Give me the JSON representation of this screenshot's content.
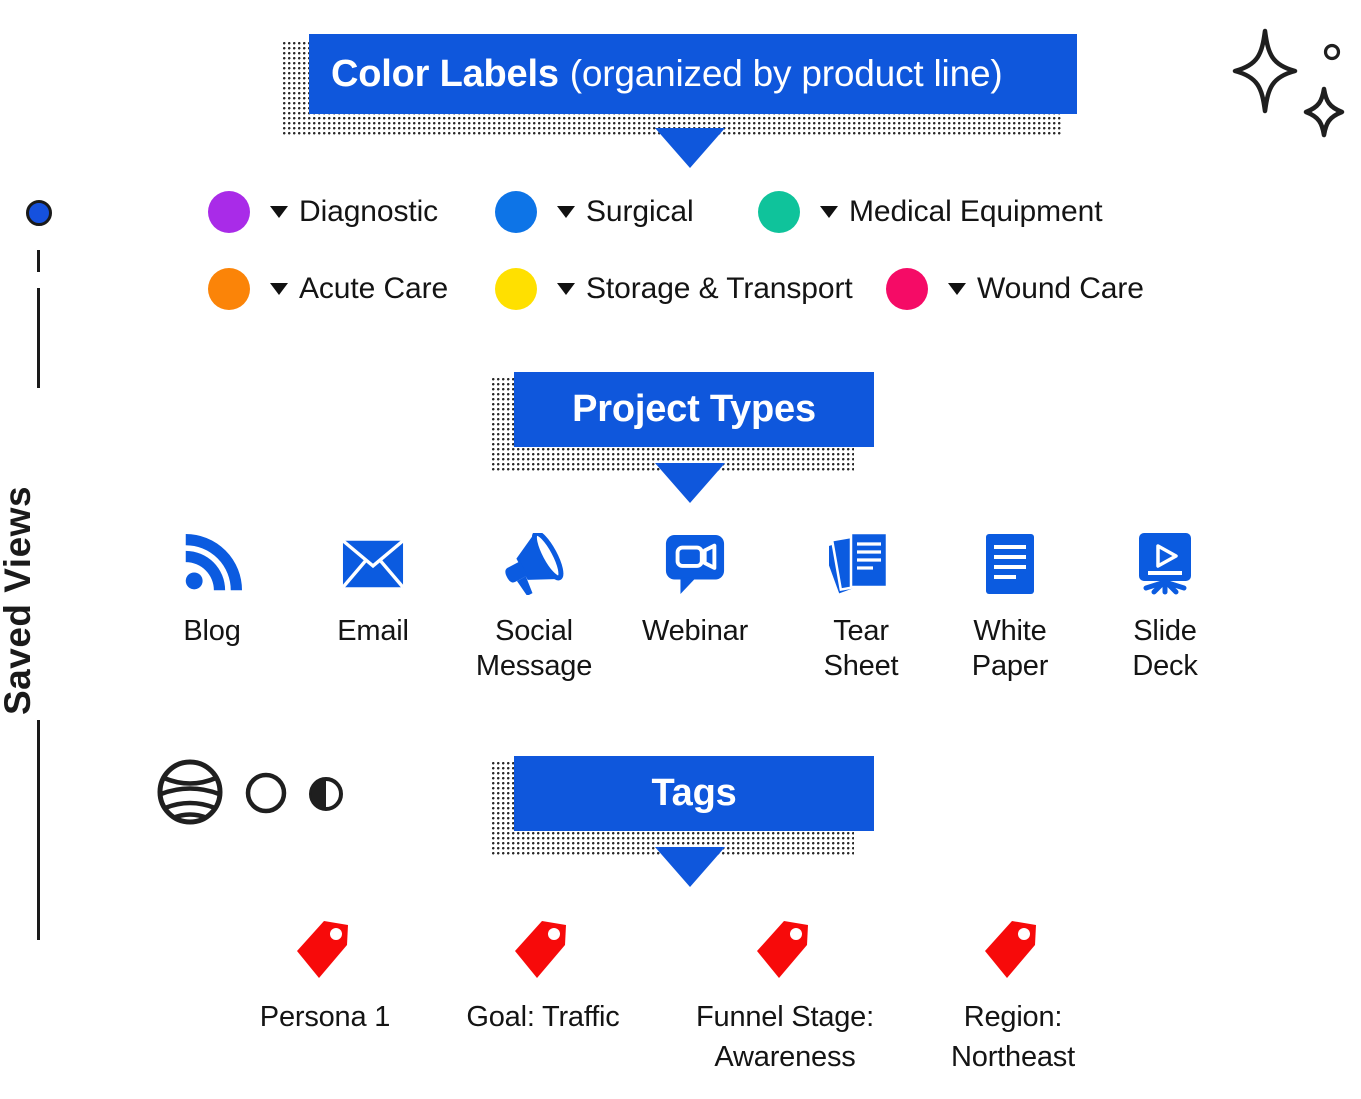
{
  "sidebar": {
    "label": "Saved Views",
    "dot_color": "#1551DE"
  },
  "sections": [
    {
      "id": "color-labels",
      "title_strong": "Color Labels",
      "title_light": "(organized by product line)",
      "banner_color": "#0F57DC"
    },
    {
      "id": "project-types",
      "title_strong": "Project Types",
      "banner_color": "#0F57DC"
    },
    {
      "id": "tags",
      "title_strong": "Tags",
      "banner_color": "#0F57DC"
    }
  ],
  "color_labels": [
    {
      "label": "Diagnostic",
      "color": "#A92BE8"
    },
    {
      "label": "Surgical",
      "color": "#0D74E7"
    },
    {
      "label": "Medical Equipment",
      "color": "#0FC39B"
    },
    {
      "label": "Acute Care",
      "color": "#FB8408"
    },
    {
      "label": "Storage & Transport",
      "color": "#FFE000"
    },
    {
      "label": "Wound Care",
      "color": "#F50B66"
    }
  ],
  "project_types": [
    {
      "label": "Blog",
      "icon": "rss-icon"
    },
    {
      "label": "Email",
      "icon": "envelope-icon"
    },
    {
      "label": "Social\nMessage",
      "icon": "megaphone-icon"
    },
    {
      "label": "Webinar",
      "icon": "video-chat-icon"
    },
    {
      "label": "Tear\nSheet",
      "icon": "stacked-documents-icon"
    },
    {
      "label": "White\nPaper",
      "icon": "document-icon"
    },
    {
      "label": "Slide\nDeck",
      "icon": "presentation-play-icon"
    }
  ],
  "tags": [
    {
      "label": "Persona 1"
    },
    {
      "label": "Goal: Traffic"
    },
    {
      "label": "Funnel Stage:\nAwareness"
    },
    {
      "label": "Region:\nNortheast"
    }
  ],
  "decorations": {
    "planet": "striped-planet-icon",
    "circle": "circle-outline-icon",
    "contrast": "half-filled-circle-icon",
    "star_large": "four-point-star-icon",
    "star_small": "four-point-star-small-icon",
    "dot": "small-circle-outline-icon"
  },
  "palette": {
    "banner_blue": "#0F57DC",
    "icon_blue": "#0B5BE0",
    "tag_red": "#F70A0A",
    "ink": "#1a1a1a"
  }
}
